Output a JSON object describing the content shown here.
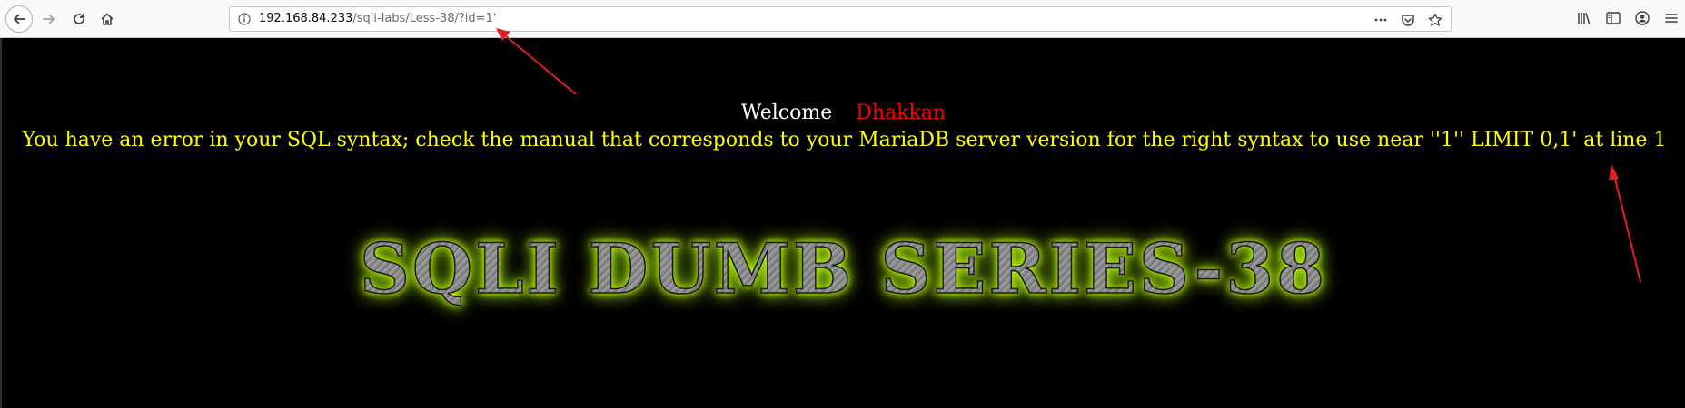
{
  "browser": {
    "url_host": "192.168.84.233",
    "url_path": "/sqli-labs/Less-38/?id=1'",
    "icons": {
      "back": "back-arrow-icon",
      "forward": "forward-arrow-icon",
      "reload": "reload-icon",
      "home": "home-icon",
      "info": "info-icon",
      "page_actions": "more-dots-icon",
      "pocket": "pocket-icon",
      "bookmark": "star-icon",
      "library": "library-icon",
      "sidebar": "sidebar-icon",
      "account": "account-icon",
      "menu": "hamburger-menu-icon"
    }
  },
  "page": {
    "welcome_word": "Welcome",
    "welcome_name": "Dhakkan",
    "error_message": "You have an error in your SQL syntax; check the manual that corresponds to your MariaDB server version for the right syntax to use near ''1'' LIMIT 0,1' at line 1",
    "logo_text": "SQLI DUMB SERIES-38"
  },
  "colors": {
    "background": "#000000",
    "welcome_word": "#ffffff",
    "welcome_name": "#ff0000",
    "error_text": "#ffff00",
    "logo_glow": "#c8ff00",
    "annotation_arrow": "#e02020"
  }
}
